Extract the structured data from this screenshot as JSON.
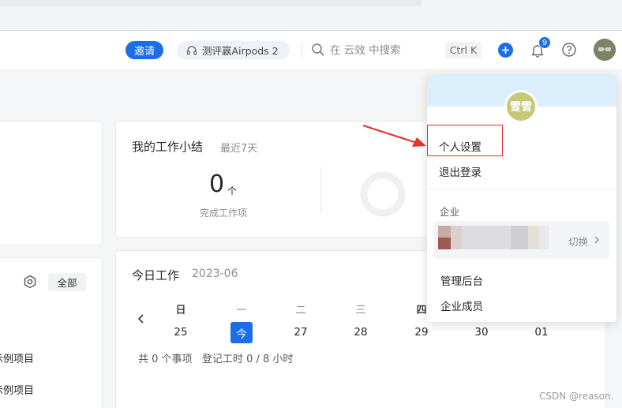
{
  "header": {
    "invite_label": "邀请",
    "promo_label": "测评赢Airpods 2",
    "search_placeholder": "在 云效 中搜索",
    "shortcut": "Ctrl K",
    "notification_count": "9",
    "accent_color": "#1b6ee6"
  },
  "summary_card": {
    "title": "我的工作小结",
    "subtitle": "最近7天",
    "count": "0",
    "unit": "个",
    "label": "完成工作项"
  },
  "left_panel": {
    "filter_label": "全部",
    "items": [
      "示例项目",
      "示例项目"
    ]
  },
  "today_card": {
    "title": "今日工作",
    "date": "2023-06",
    "weekdays": [
      "日",
      "一",
      "二",
      "三",
      "四"
    ],
    "days": [
      "25",
      "今",
      "27",
      "28",
      "29",
      "30",
      "01"
    ],
    "footer": "共 0 个事项   登记工时 0 / 8 小时"
  },
  "user_menu": {
    "avatar_text": "雪雪",
    "items": [
      "个人设置",
      "退出登录"
    ],
    "section_label": "企业",
    "org_switch_label": "切换",
    "admin_items": [
      "管理后台",
      "企业成员"
    ]
  },
  "watermark": "CSDN @reason."
}
